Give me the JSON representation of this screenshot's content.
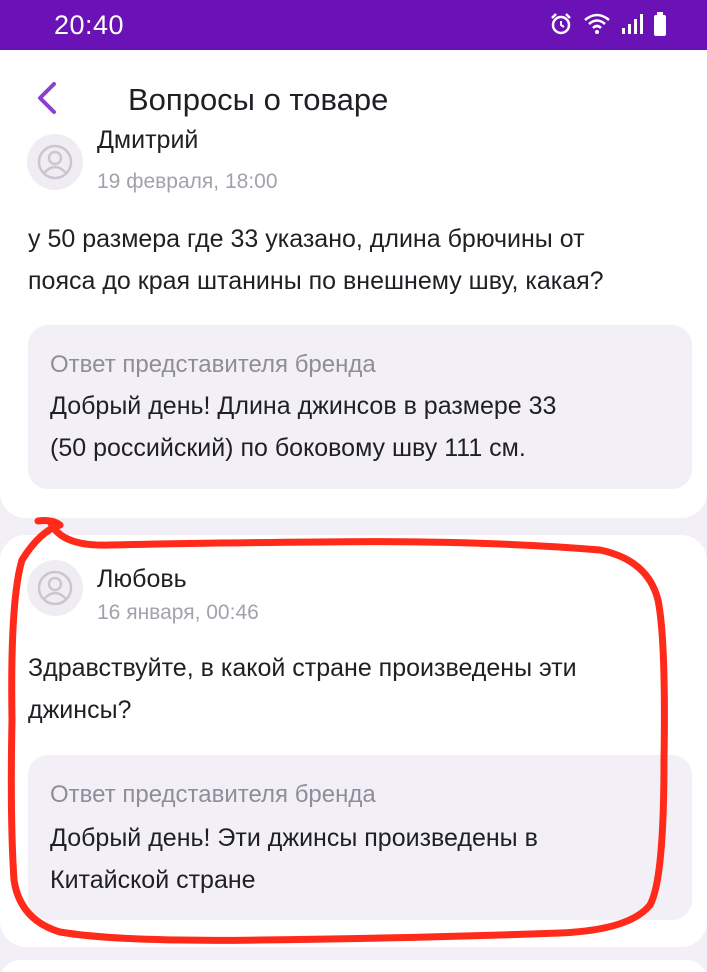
{
  "status_bar": {
    "time": "20:40",
    "icons": [
      "alarm-icon",
      "wifi-icon",
      "signal-icon",
      "battery-icon"
    ]
  },
  "header": {
    "back_icon": "chevron-left-icon",
    "title": "Вопросы о товаре"
  },
  "questions": [
    {
      "author": "Дмитрий",
      "date": "19 февраля, 18:00",
      "text_lines": [
        "у 50 размера где 33 указано, длина брючины от",
        "пояса до края штанины по внешнему шву, какая?"
      ],
      "answer_label": "Ответ представителя бренда",
      "answer_lines": [
        "Добрый день! Длина джинсов в размере 33",
        "(50 российский) по боковому шву 111 см."
      ]
    },
    {
      "author": "Любовь",
      "date": "16 января, 00:46",
      "text_lines": [
        "Здравствуйте, в какой стране произведены эти",
        "джинсы?"
      ],
      "answer_label": "Ответ представителя бренда",
      "answer_lines": [
        "Добрый день! Эти джинсы произведены в",
        "Китайской стране"
      ]
    }
  ],
  "colors": {
    "status_bar": "#6a12b5",
    "accent": "#8a3fd1",
    "highlight_stroke": "#ff2a1a",
    "background": "#f2f0f6"
  }
}
